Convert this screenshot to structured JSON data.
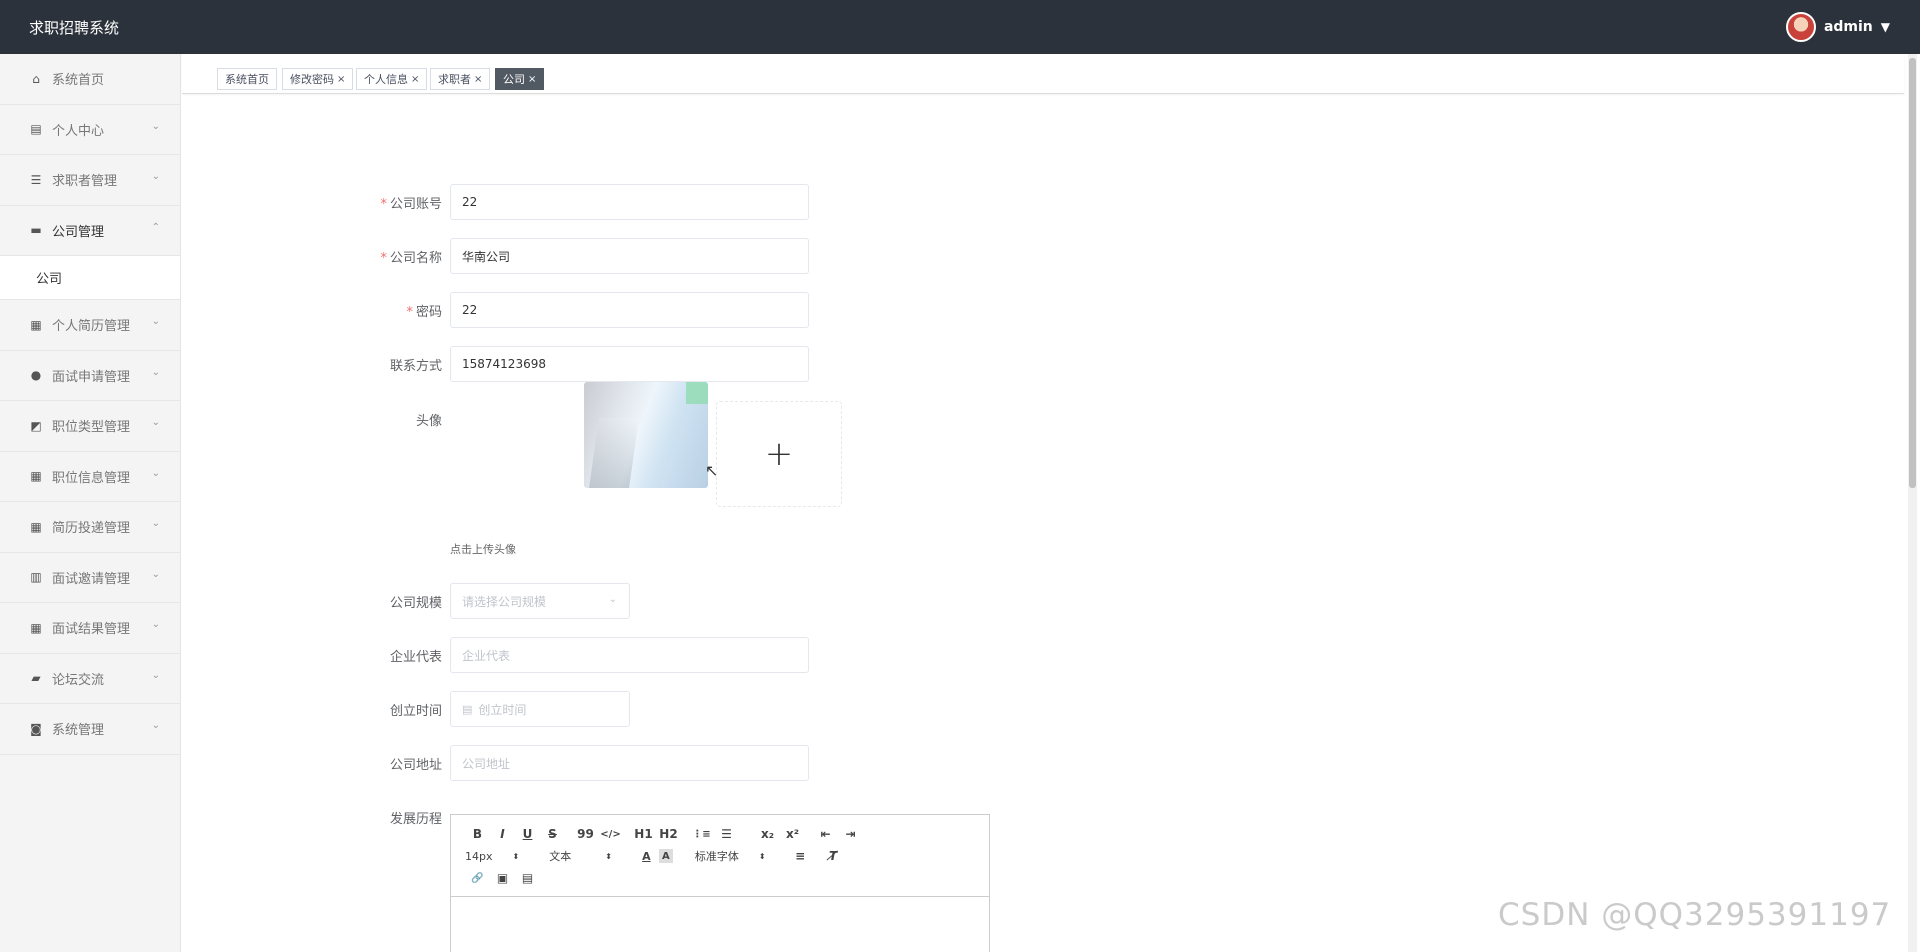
{
  "header": {
    "title": "求职招聘系统",
    "user": "admin",
    "caret": "▼"
  },
  "sidebar": {
    "items": [
      {
        "label": "系统首页",
        "icon": "⌂",
        "arrow": ""
      },
      {
        "label": "个人中心",
        "icon": "▤",
        "arrow": "⌄"
      },
      {
        "label": "求职者管理",
        "icon": "☰",
        "arrow": "⌄"
      },
      {
        "label": "公司管理",
        "icon": "▬",
        "arrow": "⌃"
      },
      {
        "label": "个人简历管理",
        "icon": "▦",
        "arrow": "⌄"
      },
      {
        "label": "面试申请管理",
        "icon": "●",
        "arrow": "⌄"
      },
      {
        "label": "职位类型管理",
        "icon": "◩",
        "arrow": "⌄"
      },
      {
        "label": "职位信息管理",
        "icon": "▦",
        "arrow": "⌄"
      },
      {
        "label": "简历投递管理",
        "icon": "▦",
        "arrow": "⌄"
      },
      {
        "label": "面试邀请管理",
        "icon": "▥",
        "arrow": "⌄"
      },
      {
        "label": "面试结果管理",
        "icon": "▦",
        "arrow": "⌄"
      },
      {
        "label": "论坛交流",
        "icon": "▰",
        "arrow": "⌄"
      },
      {
        "label": "系统管理",
        "icon": "◙",
        "arrow": "⌄"
      }
    ],
    "submenu": {
      "label": "公司"
    }
  },
  "tabs": [
    {
      "label": "系统首页",
      "close": ""
    },
    {
      "label": "修改密码",
      "close": "×"
    },
    {
      "label": "个人信息",
      "close": "×"
    },
    {
      "label": "求职者",
      "close": "×"
    },
    {
      "label": "公司",
      "close": "×"
    }
  ],
  "form": {
    "account": {
      "label": "公司账号",
      "value": "22"
    },
    "name": {
      "label": "公司名称",
      "value": "华南公司"
    },
    "password": {
      "label": "密码",
      "value": "22"
    },
    "contact": {
      "label": "联系方式",
      "value": "15874123698"
    },
    "avatar": {
      "label": "头像",
      "plus": "+",
      "hint": "点击上传头像"
    },
    "scale": {
      "label": "公司规模",
      "placeholder": "请选择公司规模",
      "arrow": "⌄"
    },
    "representative": {
      "label": "企业代表",
      "placeholder": "企业代表"
    },
    "founded": {
      "label": "创立时间",
      "placeholder": "创立时间",
      "icon": "▤"
    },
    "address": {
      "label": "公司地址",
      "placeholder": "公司地址"
    },
    "history": {
      "label": "发展历程"
    },
    "required_mark": "*"
  },
  "editor": {
    "row1": [
      "B",
      "I",
      "U",
      "S",
      "99",
      "</>",
      "H1",
      "H2",
      "⋮≡",
      "☰",
      "x₂",
      "x²",
      "⇤",
      "⇥"
    ],
    "font_size": "14px",
    "heading": "文本",
    "font_family": "标准字体",
    "row2_buttons": [
      "A",
      "A",
      "≡",
      "T̸"
    ],
    "row3": [
      "🔗",
      "▣",
      "▤"
    ],
    "select_arrow": "⬍"
  },
  "watermark": "CSDN @QQ3295391197",
  "cursor": "↖"
}
